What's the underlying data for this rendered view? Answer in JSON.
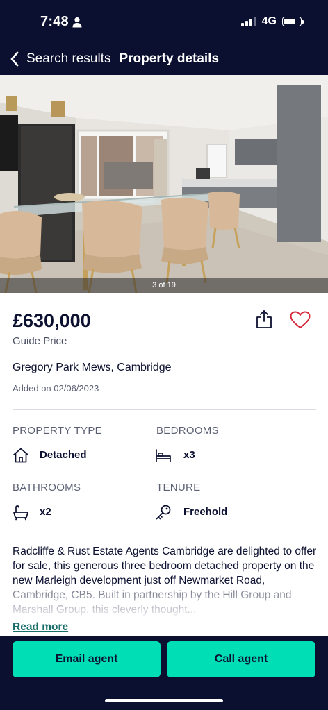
{
  "status_bar": {
    "time": "7:48",
    "network": "4G",
    "icons": [
      "person-icon",
      "signal-icon",
      "battery-icon"
    ]
  },
  "nav": {
    "back_label": "Search results",
    "title": "Property details",
    "back_icon": "chevron-left-icon"
  },
  "gallery": {
    "counter": "3 of 19"
  },
  "listing": {
    "price": "£630,000",
    "price_qualifier": "Guide Price",
    "address": "Gregory Park Mews, Cambridge",
    "added": "Added on 02/06/2023",
    "share_icon": "share-icon",
    "favourite_icon": "heart-icon"
  },
  "facts": {
    "property_type": {
      "label": "PROPERTY TYPE",
      "value": "Detached",
      "icon": "house-icon"
    },
    "bedrooms": {
      "label": "BEDROOMS",
      "value": "x3",
      "icon": "bed-icon"
    },
    "bathrooms": {
      "label": "BATHROOMS",
      "value": "x2",
      "icon": "bath-icon"
    },
    "tenure": {
      "label": "TENURE",
      "value": "Freehold",
      "icon": "key-icon"
    }
  },
  "description": {
    "text": "Radcliffe & Rust Estate Agents Cambridge are delighted to offer for sale, this generous three bedroom detached property on the new Marleigh development just off Newmarket Road, Cambridge, CB5. Built in partnership by the Hill Group and Marshall Group, this cleverly thought...",
    "read_more": "Read more"
  },
  "actions": {
    "email": "Email agent",
    "call": "Call agent"
  },
  "colors": {
    "navy": "#0c1030",
    "accent": "#00deb6",
    "link": "#1a6e6a",
    "heart": "#d6283b"
  }
}
